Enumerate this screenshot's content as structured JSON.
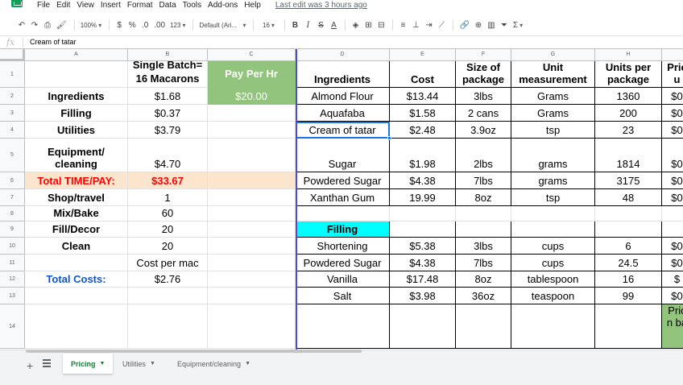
{
  "menu": {
    "items": [
      "File",
      "Edit",
      "View",
      "Insert",
      "Format",
      "Data",
      "Tools",
      "Add-ons",
      "Help"
    ],
    "last_edit": "Last edit was 3 hours ago"
  },
  "toolbar": {
    "zoom": "100%",
    "currency": "$",
    "percent": "%",
    "decrease_decimal": ".0",
    "increase_decimal": ".00",
    "more_formats": "123",
    "font": "Default (Ari...",
    "font_size": "16",
    "bold": "B",
    "italic": "I",
    "strikethrough": "S",
    "text_color": "A",
    "sum": "Σ"
  },
  "formula_bar": {
    "fx": "fx",
    "value": "Cream of tatar"
  },
  "columns": [
    "A",
    "B",
    "C",
    "D",
    "E",
    "F",
    "G",
    "H",
    ""
  ],
  "rows": [
    "1",
    "2",
    "3",
    "4",
    "5",
    "6",
    "7",
    "8",
    "9",
    "10",
    "11",
    "12",
    "13",
    "14"
  ],
  "colors": {
    "green_header": "#93c47d",
    "peach_row": "#fce5cd",
    "cyan_filling": "#00ffff",
    "red_total": "#ff0000",
    "blue_total": "#1155cc",
    "tab_active": "#188038"
  },
  "cells": {
    "B1": "Single Batch= 16 Macarons",
    "C1": "Pay Per Hr",
    "D1": "Ingredients",
    "E1": "Cost",
    "F1": "Size of package",
    "G1": "Unit measurement",
    "H1": "Units per package",
    "I1": "Pric u",
    "A2": "Ingredients",
    "B2": "$1.68",
    "C2": "$20.00",
    "D2": "Almond Flour",
    "E2": "$13.44",
    "F2": "3lbs",
    "G2": "Grams",
    "H2": "1360",
    "I2": "$0",
    "A3": "Filling",
    "B3": "$0.37",
    "D3": "Aquafaba",
    "E3": "$1.58",
    "F3": "2 cans",
    "G3": "Grams",
    "H3": "200",
    "I3": "$0",
    "A4": "Utilities",
    "B4": "$3.79",
    "D4": "Cream of tatar",
    "E4": "$2.48",
    "F4": "3.9oz",
    "G4": "tsp",
    "H4": "23",
    "I4": "$0",
    "A5": "Equipment/ cleaning",
    "B5": "$4.70",
    "D5": "Sugar",
    "E5": "$1.98",
    "F5": "2lbs",
    "G5": "grams",
    "H5": "1814",
    "I5": "$0",
    "A6": "Total TIME/PAY:",
    "B6": "$33.67",
    "D6": "Powdered Sugar",
    "E6": "$4.38",
    "F6": "7lbs",
    "G6": "grams",
    "H6": "3175",
    "I6": "$0",
    "A7": "Shop/travel",
    "B7": "1",
    "D7": "Xanthan Gum",
    "E7": "19.99",
    "F7": "8oz",
    "G7": "tsp",
    "H7": "48",
    "I7": "$0",
    "A8": "Mix/Bake",
    "B8": "60",
    "A9": "Fill/Decor",
    "B9": "20",
    "D9": "Filling",
    "A10": "Clean",
    "B10": "20",
    "D10": "Shortening",
    "E10": "$5.38",
    "F10": "3lbs",
    "G10": "cups",
    "H10": "6",
    "I10": "$0",
    "B11": "Cost per mac",
    "D11": "Powdered Sugar",
    "E11": "$4.38",
    "F11": "7lbs",
    "G11": "cups",
    "H11": "24.5",
    "I11": "$0",
    "A12": "Total Costs:",
    "B12": "$2.76",
    "D12": "Vanilla",
    "E12": "$17.48",
    "F12": "8oz",
    "G12": "tablespoon",
    "H12": "16",
    "I12": "$",
    "D13": "Salt",
    "E13": "$3.98",
    "F13": "36oz",
    "G13": "teaspoon",
    "H13": "99",
    "I13": "$0",
    "I14": "Pric n ba"
  },
  "sheets": [
    {
      "name": "Pricing",
      "active": true
    },
    {
      "name": "Utilities",
      "active": false
    },
    {
      "name": "Equipment/cleaning",
      "active": false
    }
  ]
}
